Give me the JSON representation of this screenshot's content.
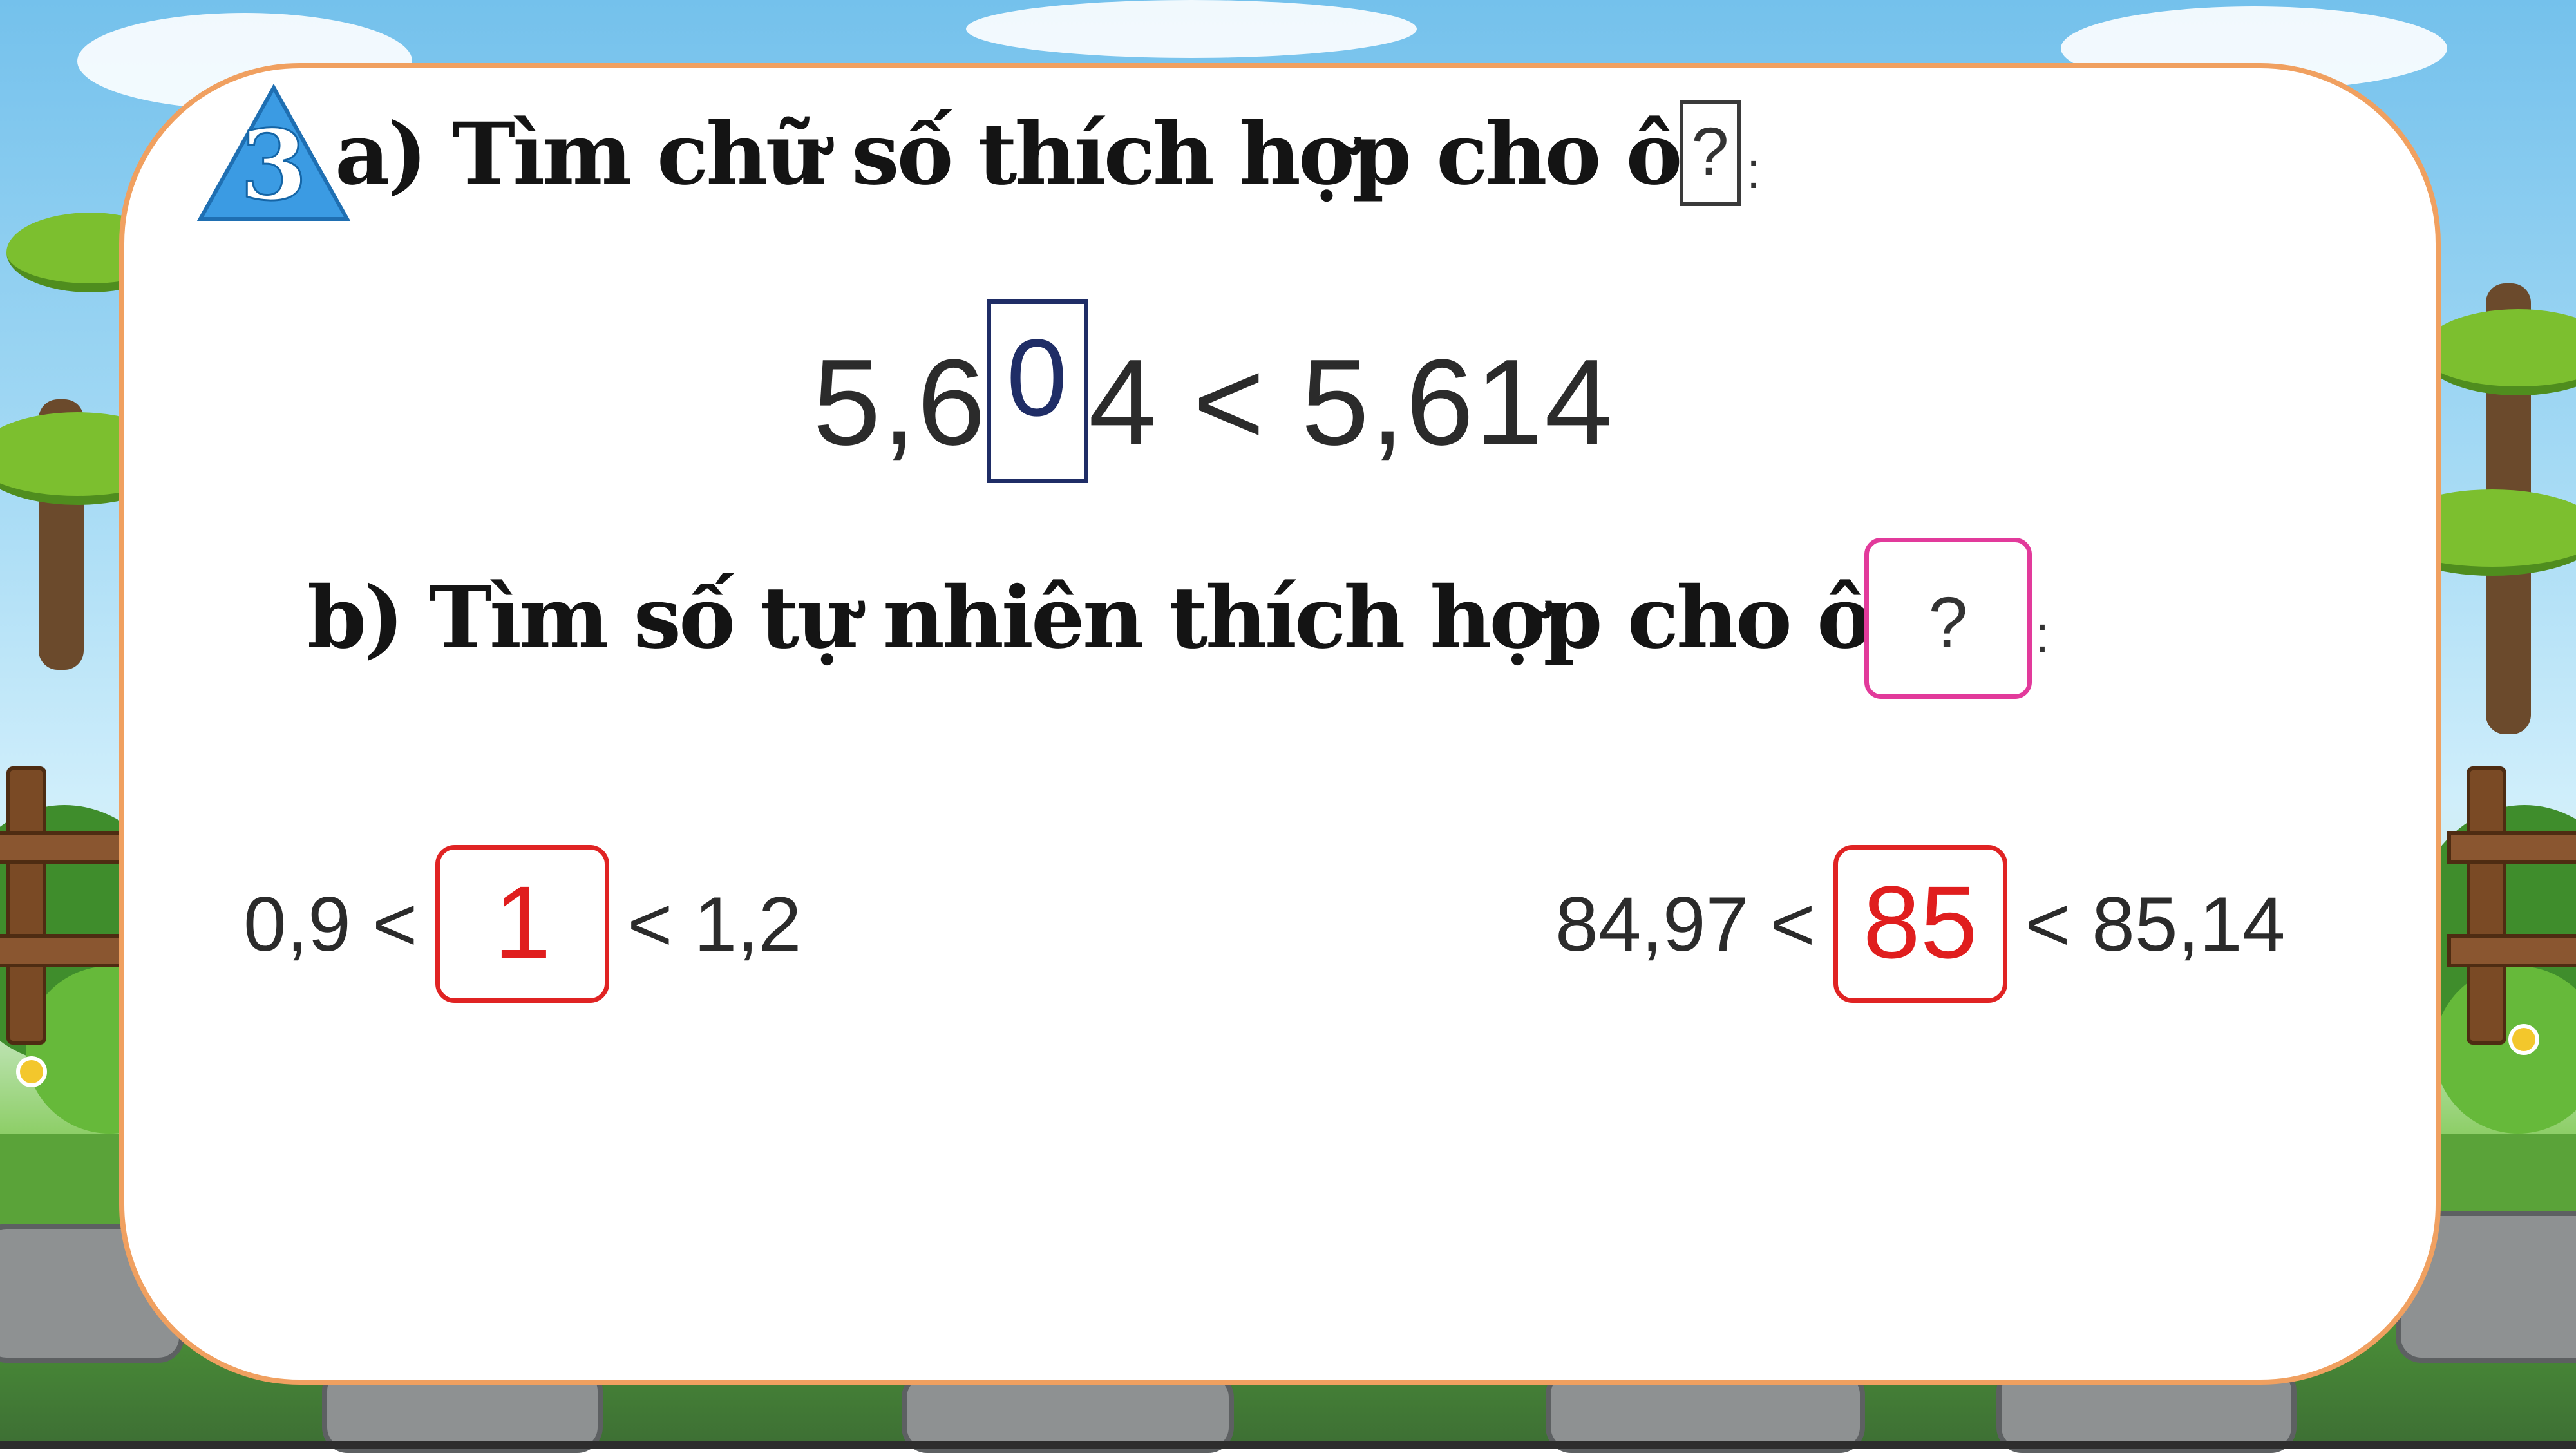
{
  "exercise": {
    "number": "3",
    "part_a": {
      "prompt": "a) Tìm chữ số thích hợp cho ô",
      "placeholder_symbol": "?",
      "colon": ":",
      "left_before": "5,6",
      "digit_answer": "0",
      "left_after": "4",
      "operator": "<",
      "right_value": "5,614"
    },
    "part_b": {
      "prompt": "b) Tìm số tự nhiên thích hợp cho ô",
      "placeholder_symbol": "?",
      "colon": ":",
      "items": [
        {
          "left": "0,9 <",
          "answer": "1",
          "right": "< 1,2"
        },
        {
          "left": "84,97 <",
          "answer": "85",
          "right": "< 85,14"
        }
      ]
    }
  },
  "colors": {
    "card_border": "#f0a060",
    "badge_fill": "#3b9be3",
    "digit_box": "#1f2d66",
    "answer_red": "#e01e1e",
    "placeholder_pink": "#e23a9b"
  }
}
